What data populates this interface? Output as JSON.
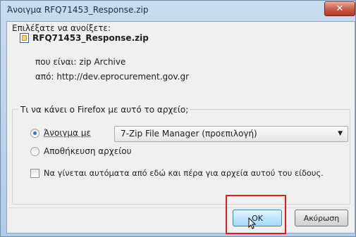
{
  "window": {
    "title": "Άνοιγμα RFQ71453_Response.zip",
    "close_label": "✕"
  },
  "body": {
    "prompt": "Επιλέξατε να ανοίξετε:",
    "filename": "RFQ71453_Response.zip",
    "type_line": "που είναι: zip Archive",
    "from_line": "από: http://dev.eprocurement.gov.gr"
  },
  "group": {
    "label": "Τι να κάνει ο Firefox  με αυτό το αρχείο;",
    "open_with": {
      "label": "Άνοιγμα με",
      "checked": true
    },
    "app_select": {
      "value": "7-Zip File Manager (προεπιλογή)"
    },
    "save_file": {
      "label": "Αποθήκευση αρχείου",
      "checked": false
    },
    "auto_checkbox": {
      "label": "Να γίνεται αυτόματα από εδώ και πέρα για αρχεία αυτού του είδους.",
      "checked": false
    }
  },
  "buttons": {
    "ok": "OK",
    "cancel": "Ακύρωση"
  },
  "colors": {
    "highlight": "#e21c1c",
    "close_button": "#c95a42"
  },
  "icons": [
    "file-icon",
    "close-icon",
    "chevron-down-icon",
    "mouse-cursor-icon"
  ]
}
